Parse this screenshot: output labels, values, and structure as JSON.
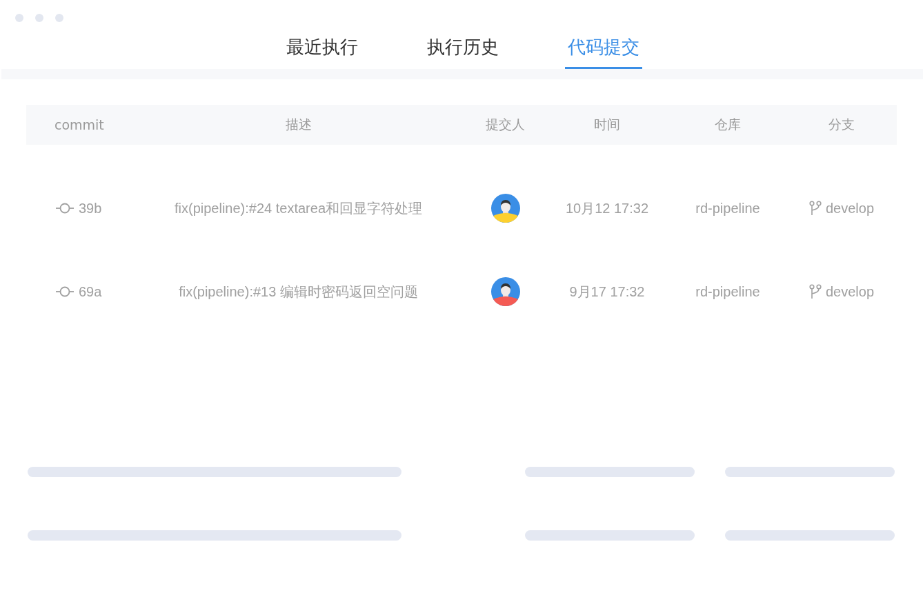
{
  "tabs": [
    {
      "label": "最近执行",
      "selected": false
    },
    {
      "label": "执行历史",
      "selected": false
    },
    {
      "label": "代码提交",
      "selected": true
    }
  ],
  "table": {
    "columns": [
      "commit",
      "描述",
      "提交人",
      "时间",
      "仓库",
      "分支"
    ],
    "rows": [
      {
        "commit": "39b",
        "description": "fix(pipeline):#24 textarea和回显字符处理",
        "color": "#fdd02f",
        "time": "10月12 17:32",
        "repository": "rd-pipeline",
        "branch": "develop"
      },
      {
        "commit": "69a",
        "description": "fix(pipeline):#13 编辑时密码返回空问题",
        "color": "#f45b54",
        "time": "9月17 17:32",
        "repository": "rd-pipeline",
        "branch": "develop"
      }
    ]
  },
  "placeholder_rows": [
    {
      "kind": "skeleton"
    },
    {
      "kind": "skeleton"
    }
  ]
}
